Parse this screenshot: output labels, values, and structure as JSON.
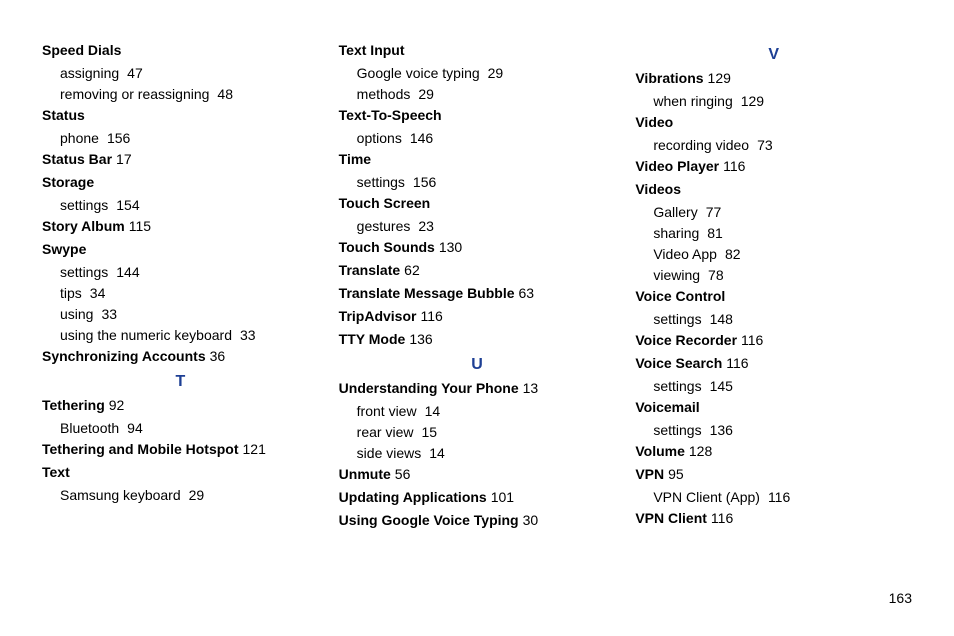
{
  "pageNumber": "163",
  "columns": [
    [
      {
        "type": "entry",
        "term": "Speed Dials",
        "page": "",
        "subs": [
          {
            "text": "assigning",
            "page": "47"
          },
          {
            "text": "removing or reassigning",
            "page": "48"
          }
        ]
      },
      {
        "type": "entry",
        "term": "Status",
        "page": "",
        "subs": [
          {
            "text": "phone",
            "page": "156"
          }
        ]
      },
      {
        "type": "entry",
        "term": "Status Bar",
        "page": "17",
        "subs": []
      },
      {
        "type": "entry",
        "term": "Storage",
        "page": "",
        "subs": [
          {
            "text": "settings",
            "page": "154"
          }
        ]
      },
      {
        "type": "entry",
        "term": "Story Album",
        "page": "115",
        "subs": []
      },
      {
        "type": "entry",
        "term": "Swype",
        "page": "",
        "subs": [
          {
            "text": "settings",
            "page": "144"
          },
          {
            "text": "tips",
            "page": "34"
          },
          {
            "text": "using",
            "page": "33"
          },
          {
            "text": "using the numeric keyboard",
            "page": "33"
          }
        ]
      },
      {
        "type": "entry",
        "term": "Synchronizing Accounts",
        "page": "36",
        "subs": []
      },
      {
        "type": "letter",
        "text": "T"
      },
      {
        "type": "entry",
        "term": "Tethering",
        "page": "92",
        "subs": [
          {
            "text": "Bluetooth",
            "page": "94"
          }
        ]
      },
      {
        "type": "entry",
        "term": "Tethering and Mobile Hotspot",
        "page": "121",
        "subs": []
      },
      {
        "type": "entry",
        "term": "Text",
        "page": "",
        "subs": [
          {
            "text": "Samsung keyboard",
            "page": "29"
          }
        ]
      }
    ],
    [
      {
        "type": "entry",
        "term": "Text Input",
        "page": "",
        "subs": [
          {
            "text": "Google voice typing",
            "page": "29"
          },
          {
            "text": "methods",
            "page": "29"
          }
        ]
      },
      {
        "type": "entry",
        "term": "Text-To-Speech",
        "page": "",
        "subs": [
          {
            "text": "options",
            "page": "146"
          }
        ]
      },
      {
        "type": "entry",
        "term": "Time",
        "page": "",
        "subs": [
          {
            "text": "settings",
            "page": "156"
          }
        ]
      },
      {
        "type": "entry",
        "term": "Touch Screen",
        "page": "",
        "subs": [
          {
            "text": "gestures",
            "page": "23"
          }
        ]
      },
      {
        "type": "entry",
        "term": "Touch Sounds",
        "page": "130",
        "subs": []
      },
      {
        "type": "entry",
        "term": "Translate",
        "page": "62",
        "subs": []
      },
      {
        "type": "entry",
        "term": "Translate Message Bubble",
        "page": "63",
        "subs": []
      },
      {
        "type": "entry",
        "term": "TripAdvisor",
        "page": "116",
        "subs": []
      },
      {
        "type": "entry",
        "term": "TTY Mode",
        "page": "136",
        "subs": []
      },
      {
        "type": "letter",
        "text": "U"
      },
      {
        "type": "entry",
        "term": "Understanding Your Phone",
        "page": "13",
        "subs": [
          {
            "text": "front view",
            "page": "14"
          },
          {
            "text": "rear view",
            "page": "15"
          },
          {
            "text": "side views",
            "page": "14"
          }
        ]
      },
      {
        "type": "entry",
        "term": "Unmute",
        "page": "56",
        "subs": []
      },
      {
        "type": "entry",
        "term": "Updating Applications",
        "page": "101",
        "subs": []
      },
      {
        "type": "entry",
        "term": "Using Google Voice Typing",
        "page": "30",
        "subs": []
      }
    ],
    [
      {
        "type": "letter",
        "text": "V"
      },
      {
        "type": "entry",
        "term": "Vibrations",
        "page": "129",
        "subs": [
          {
            "text": "when ringing",
            "page": "129"
          }
        ]
      },
      {
        "type": "entry",
        "term": "Video",
        "page": "",
        "subs": [
          {
            "text": "recording video",
            "page": "73"
          }
        ]
      },
      {
        "type": "entry",
        "term": "Video Player",
        "page": "116",
        "subs": []
      },
      {
        "type": "entry",
        "term": "Videos",
        "page": "",
        "subs": [
          {
            "text": "Gallery",
            "page": "77"
          },
          {
            "text": "sharing",
            "page": "81"
          },
          {
            "text": "Video App",
            "page": "82"
          },
          {
            "text": "viewing",
            "page": "78"
          }
        ]
      },
      {
        "type": "entry",
        "term": "Voice Control",
        "page": "",
        "subs": [
          {
            "text": "settings",
            "page": "148"
          }
        ]
      },
      {
        "type": "entry",
        "term": "Voice Recorder",
        "page": "116",
        "subs": []
      },
      {
        "type": "entry",
        "term": "Voice Search",
        "page": "116",
        "subs": [
          {
            "text": "settings",
            "page": "145"
          }
        ]
      },
      {
        "type": "entry",
        "term": "Voicemail",
        "page": "",
        "subs": [
          {
            "text": "settings",
            "page": "136"
          }
        ]
      },
      {
        "type": "entry",
        "term": "Volume",
        "page": "128",
        "subs": []
      },
      {
        "type": "entry",
        "term": "VPN",
        "page": "95",
        "subs": [
          {
            "text": "VPN Client (App)",
            "page": "116"
          }
        ]
      },
      {
        "type": "entry",
        "term": "VPN Client",
        "page": "116",
        "subs": []
      }
    ]
  ]
}
